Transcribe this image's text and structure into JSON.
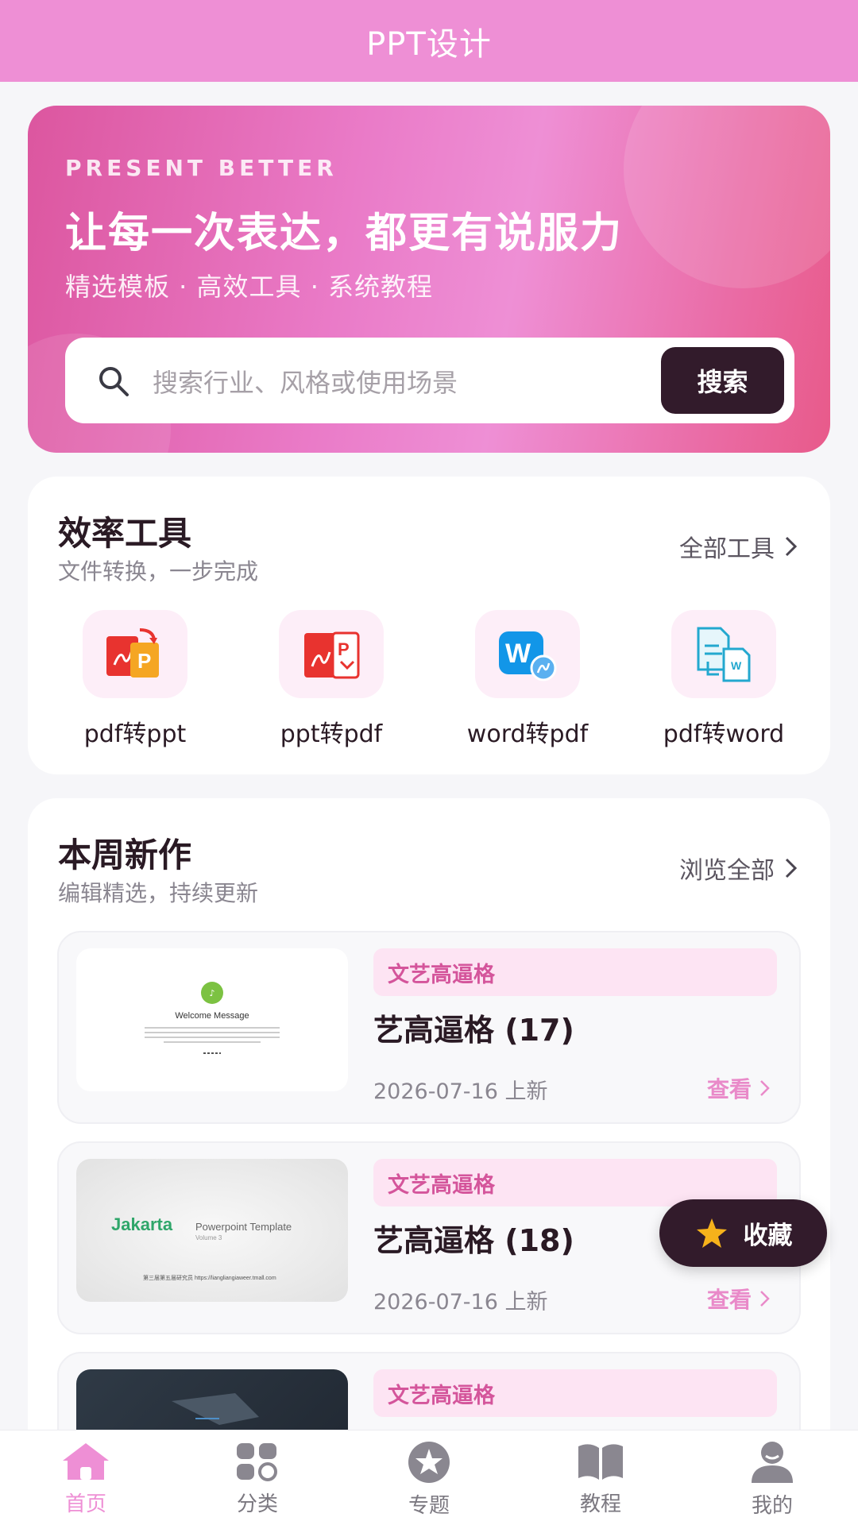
{
  "app": {
    "title": "PPT设计"
  },
  "hero": {
    "kicker": "PRESENT BETTER",
    "headline": "让每一次表达，都更有说服力",
    "subtitle": "精选模板 · 高效工具 · 系统教程",
    "search_placeholder": "搜索行业、风格或使用场景",
    "search_button": "搜索"
  },
  "tools": {
    "title": "效率工具",
    "subtitle": "文件转换，一步完成",
    "link": "全部工具",
    "items": [
      {
        "label": "pdf转ppt",
        "icon": "pdf-to-ppt-icon"
      },
      {
        "label": "ppt转pdf",
        "icon": "ppt-to-pdf-icon"
      },
      {
        "label": "word转pdf",
        "icon": "word-to-pdf-icon"
      },
      {
        "label": "pdf转word",
        "icon": "pdf-to-word-icon"
      }
    ]
  },
  "new_works": {
    "title": "本周新作",
    "subtitle": "编辑精选，持续更新",
    "link": "浏览全部",
    "items": [
      {
        "tag": "文艺高逼格",
        "title": "艺高逼格 (17)",
        "date": "2026-07-16 上新",
        "action": "查看",
        "thumb_heading": "Welcome Message"
      },
      {
        "tag": "文艺高逼格",
        "title": "艺高逼格 (18)",
        "date": "2026-07-16 上新",
        "action": "查看",
        "thumb_heading": "Jakarta",
        "thumb_sub": "Powerpoint Template",
        "thumb_vol": "Volume 3",
        "thumb_footer": "第三届第五届研究员 https://liangliangiaweer.tmall.com"
      },
      {
        "tag": "文艺高逼格",
        "title": "",
        "date": "",
        "action": ""
      }
    ]
  },
  "favorite_button": "收藏",
  "nav": {
    "items": [
      {
        "label": "首页",
        "icon": "home-icon",
        "active": true
      },
      {
        "label": "分类",
        "icon": "category-icon",
        "active": false
      },
      {
        "label": "专题",
        "icon": "topic-star-icon",
        "active": false
      },
      {
        "label": "教程",
        "icon": "book-icon",
        "active": false
      },
      {
        "label": "我的",
        "icon": "user-icon",
        "active": false
      }
    ]
  },
  "colors": {
    "brand_pink": "#ee8fd5",
    "dark": "#321b2b",
    "tag_bg": "#fde4f3",
    "tag_text": "#d4559b"
  }
}
